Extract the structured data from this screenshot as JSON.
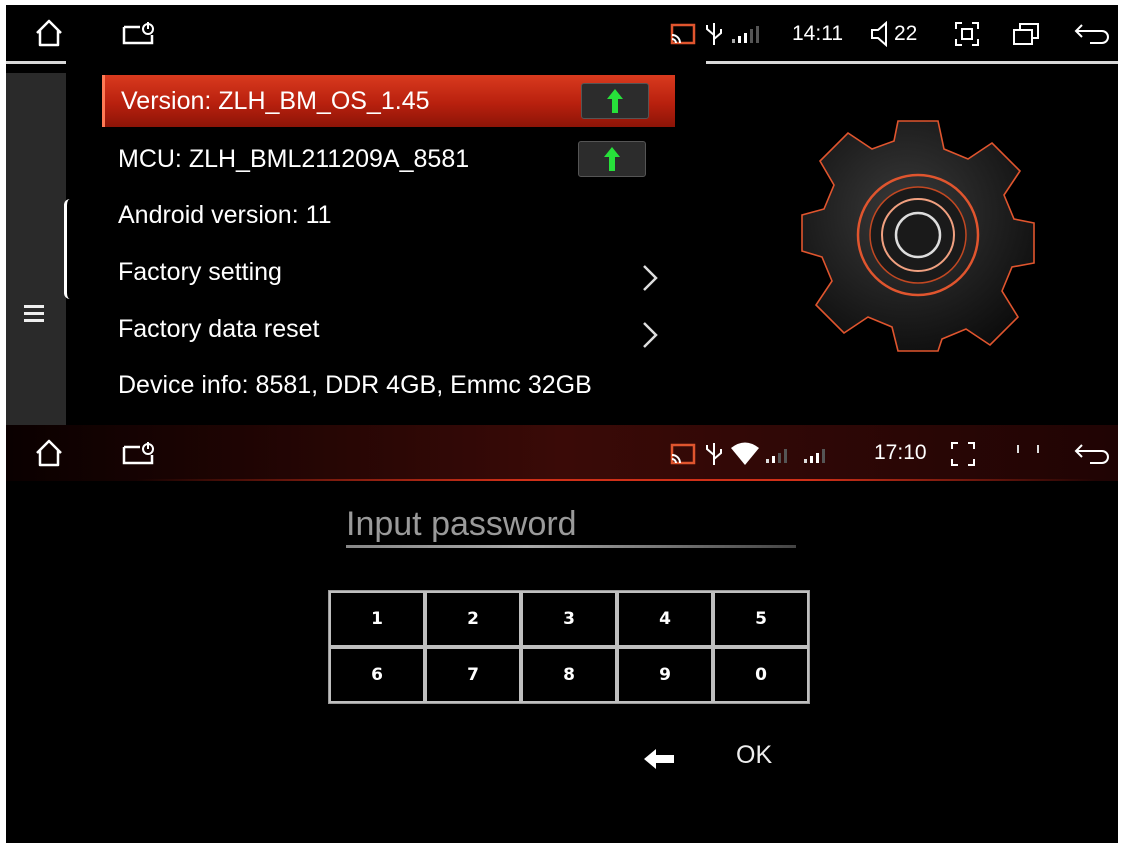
{
  "status_bar_top": {
    "time": "14:11",
    "volume": "22"
  },
  "settings": {
    "version": {
      "label": "Version:  ZLH_BM_OS_1.45"
    },
    "mcu": {
      "label": "MCU:  ZLH_BML211209A_8581"
    },
    "android": {
      "label": "Android version:  11"
    },
    "factory_setting": {
      "label": "Factory setting"
    },
    "factory_reset": {
      "label": "Factory data reset"
    },
    "device_info": {
      "label": "Device info:  8581, DDR 4GB, Emmc 32GB"
    }
  },
  "status_bar_bottom": {
    "time": "17:10"
  },
  "password": {
    "label": "Input password",
    "keys": [
      "1",
      "2",
      "3",
      "4",
      "5",
      "6",
      "7",
      "8",
      "9",
      "0"
    ],
    "ok_label": "OK"
  },
  "icons": {
    "home": "home-icon",
    "screen_power": "screen-power-icon",
    "cast": "cast-icon",
    "usb": "usb-icon",
    "signal": "signal-icon",
    "wifi": "wifi-icon",
    "volume": "volume-icon",
    "screenshot": "screenshot-icon",
    "recent": "recent-apps-icon",
    "back": "back-icon",
    "menu": "menu-icon",
    "upgrade": "upgrade-arrow-icon",
    "chevron": "chevron-right-icon",
    "gear": "gear-icon",
    "backspace": "backspace-icon"
  },
  "colors": {
    "selected_row": "#c42a14",
    "upgrade_arrow": "#27e03a",
    "gear_outline": "#e0552e",
    "accent_line": "#d03018"
  }
}
